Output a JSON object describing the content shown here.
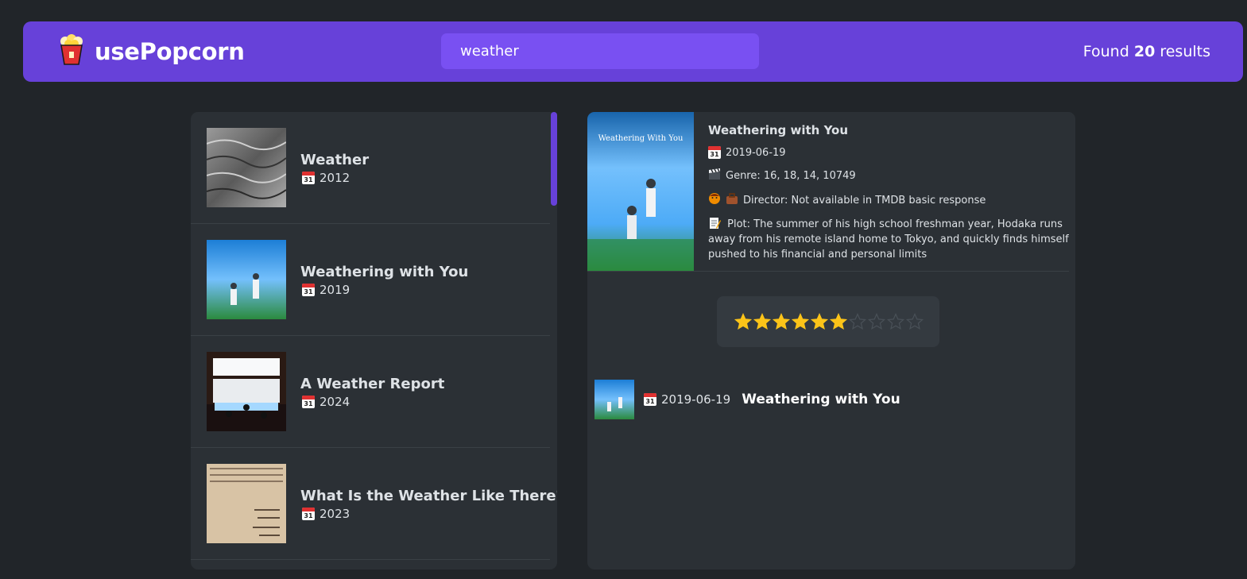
{
  "navbar": {
    "logo_text": "usePopcorn",
    "logo_icon": "popcorn-icon",
    "search_value": "weather",
    "results_prefix": "Found",
    "results_count": "20",
    "results_suffix": "results"
  },
  "movies": [
    {
      "title": "Weather",
      "year": "2012"
    },
    {
      "title": "Weathering with You",
      "year": "2019"
    },
    {
      "title": "A Weather Report",
      "year": "2024"
    },
    {
      "title": "What Is the Weather Like There?",
      "year": "2023"
    }
  ],
  "details": {
    "title": "Weathering with You",
    "release_date": "2019-06-19",
    "genre": "Genre: 16, 18, 14, 10749",
    "director": "Director: Not available in TMDB basic response",
    "plot": "Plot: The summer of his high school freshman year, Hodaka runs away from his remote island home to Tokyo, and quickly finds himself pushed to his financial and personal limits",
    "poster_caption": "Weathering With You",
    "rating": {
      "value": 6,
      "max": 10
    }
  },
  "watched": {
    "date": "2019-06-19",
    "title": "Weathering with You"
  },
  "colors": {
    "background": "#212529",
    "navbar": "#6741d9",
    "search": "#7950f2",
    "panel": "#2b3035",
    "star": "#fcc419"
  }
}
